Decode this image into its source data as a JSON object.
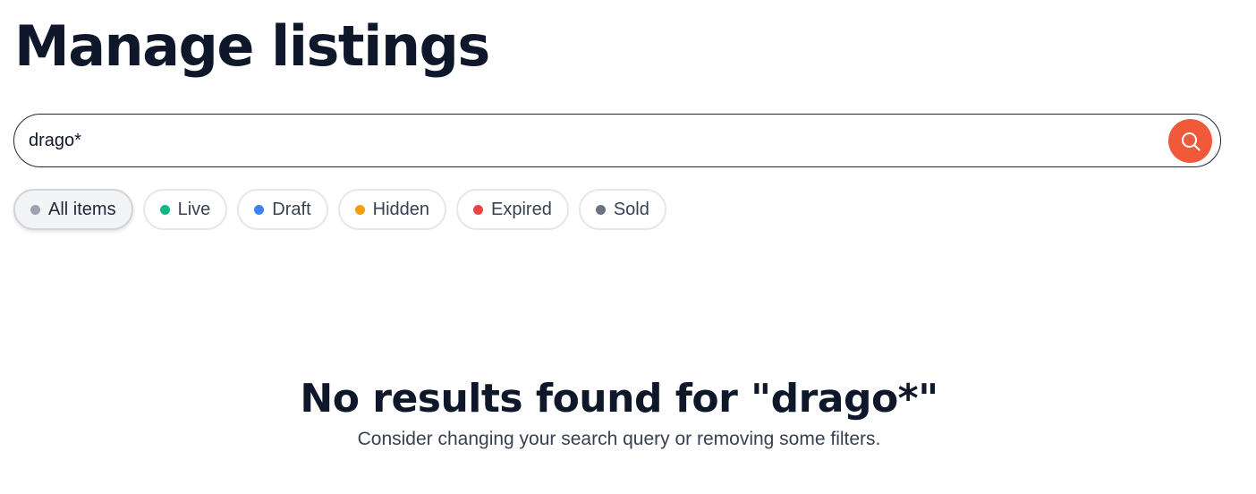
{
  "page": {
    "title": "Manage listings"
  },
  "search": {
    "value": "drago*",
    "button_icon": "search-icon",
    "button_color": "#f05a3a"
  },
  "filters": [
    {
      "label": "All items",
      "dot_color": "#9ca3af",
      "active": true
    },
    {
      "label": "Live",
      "dot_color": "#10b981",
      "active": false
    },
    {
      "label": "Draft",
      "dot_color": "#3b82f6",
      "active": false
    },
    {
      "label": "Hidden",
      "dot_color": "#f59e0b",
      "active": false
    },
    {
      "label": "Expired",
      "dot_color": "#ef4444",
      "active": false
    },
    {
      "label": "Sold",
      "dot_color": "#6b7280",
      "active": false
    }
  ],
  "empty_state": {
    "title": "No results found for \"drago*\"",
    "subtitle": "Consider changing your search query or removing some filters."
  }
}
